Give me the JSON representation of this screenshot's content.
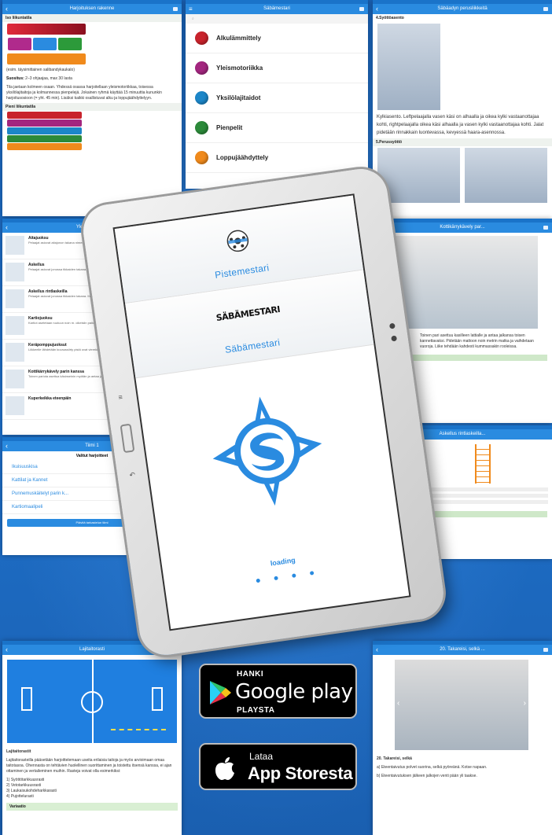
{
  "colors": {
    "app_bar": "#2a8be0",
    "background": "#1e6fc8",
    "accent": "#2a8be0"
  },
  "shot_top_left": {
    "title": "Harjoituksen rakenne",
    "section1": "Iso liikuntatila",
    "text1": "(esim. täysimittainen salibandykaukalo)",
    "text2_label": "Suositus:",
    "text2": "2–3 ohjaajaa, max 30 lasta",
    "text3": "Tila jaetaan kolmeen osaan. Yhdessä osassa harjoitellaan yleismotoriikkaa, toisessa yksilölajitaitoja ja kolmannessa pienpelejä. Jokainen ryhmä käyttää 15 minuuttia kununkin harjoitusosioon (= yht. 45 min). Lisäksi kaikki osallistuvat alku ja loppujäähdyttelyyn.",
    "section2": "Pieni liikuntatila"
  },
  "shot_top_mid": {
    "title": "Säbämestari",
    "categories": [
      {
        "label": "Alkulämmittely",
        "color": "#c8232c"
      },
      {
        "label": "Yleismotoriikka",
        "color": "#a3267f"
      },
      {
        "label": "Yksilölajitaidot",
        "color": "#1c86c8"
      },
      {
        "label": "Pienpelit",
        "color": "#2c8a3a"
      },
      {
        "label": "Loppujäähdyttely",
        "color": "#f08a1c"
      }
    ]
  },
  "shot_top_right": {
    "title": "Säbäadyn perusliikkeitä",
    "heading1": "4.Syöttöasento",
    "text1": "Kylkiasento. Leftpelaajalla vasen käsi on alhaalla ja oikea kylki vastaanottajaa kohti, rightpelaajalla oikea käsi alhaalla ja vasen kylki vastaanottajaa kohti. Jalat pidetään rinnakkain luontevassa, kevyessä haara-asennossa.",
    "heading2": "5.Perussyöttö"
  },
  "shot_mid_left": {
    "title": "Yleismotoriikka",
    "rows": [
      {
        "title": "Aitajuoksu",
        "desc": "Pelaajat asiovat aitajonon takana nimenomaisella riviarvolla."
      },
      {
        "title": "Askellus",
        "desc": "Pelaajat asiovat jonossa tikkaiden takana. Ihmetoimuistaalleen."
      },
      {
        "title": "Askellus rintlaskeilla",
        "desc": "Pelaajat asiovat jonossa tikkaiden takana. Ihmetoimuistaalleen."
      },
      {
        "title": "Kartiojuoksu",
        "desc": "Kartiot asetetaan ruutuun noin m. oikeisiin paikkoihinsa."
      },
      {
        "title": "Keräpomppujuoksut",
        "desc": "Liikkeelle lähdetään kuvaussiirty pistä ovat vierekkäin."
      },
      {
        "title": "Kottikärrykävely parin kanssa",
        "desc": "Toinen pariota asettua käsinseinin myötän ja antaa jalkansa toisen kannettavaksi."
      },
      {
        "title": "Kuperkeikka eteenpäin",
        "desc": ""
      }
    ]
  },
  "shot_mid_right": {
    "title": "Kottikärrykävely par...",
    "text": "Toinen pari asettuu kasilleen lattialle ja antaa jalkansa toisen kannettavaksi. Pidetään mattoon noin metrin matka ja vaihdetaan vuoroja. Liike tehdään kahdesti kummassakin rooleissa."
  },
  "shot_lower_left": {
    "title": "Tiimi 1",
    "subtitle": "Valitut harjoitteet",
    "items": [
      "Ikuisuuskisa",
      "Kattilat ja Kannet",
      "Punnemuskäitelyt parin k...",
      "Kartiomaalipeli"
    ],
    "button": "Päivitä tarkastelun tiimi"
  },
  "shot_lower_right": {
    "title": "Askellus rintlaskeilla..."
  },
  "shot_bottom_left": {
    "title": "Lajitaitorasti",
    "heading": "Lajitaitorastit",
    "text": "Lajitaitorasteilla pääsetään harjoittelemaan useita erilaisia taitoja ja myös arvioimaan omaa taitotasoa. Ohennasta on tehtävien huolellinen suorittaminen ja toistettu itsensä kanssa, ei ajan ottaminen ja vertaileminen muihin. Rasteja voivat olla esimerkiksi:",
    "list": [
      "1) Syöttötarkkuusrasti",
      "2) Vetotarkkuusrasti",
      "3) Laukaisukohdeharkkarasti",
      "4) Pujottelurasti"
    ],
    "footer": "Variaatio"
  },
  "shot_bottom_right": {
    "title": "20. Takareisi, selkä ...",
    "caption": "20. Takareisi, selkä",
    "line1": "a) Eteentaivutus polvet suorina, selkä pyöreänä. Kotse napaan.",
    "line2": "b) Eteentaivutuksen jälkeen jalkojen venti pään yli taakse."
  },
  "tablet": {
    "tile1_name": "Pistemestari",
    "tile2_wordmark": "SÄBÄMESTARI",
    "tile2_name": "Säbämestari",
    "loading": "loading"
  },
  "badges": {
    "google_kicker": "HANKI",
    "google_main": "Google play",
    "google_sub": "PLAYSTA",
    "apple_kicker": "Lataa",
    "apple_main": "App Storesta"
  }
}
